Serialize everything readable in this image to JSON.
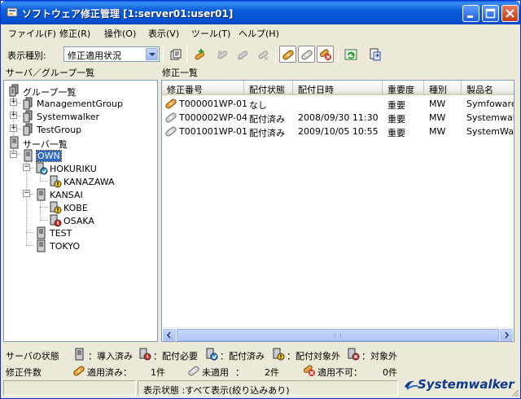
{
  "window": {
    "title": "ソフトウェア修正管理 [1:server01:user01]",
    "title_color": "#0a5fd8"
  },
  "menu": [
    "ファイル(F)",
    "修正(R)",
    "操作(O)",
    "表示(V)",
    "ツール(T)",
    "ヘルプ(H)"
  ],
  "toolbar": {
    "label": "表示種別:",
    "combo_value": "修正適用状況"
  },
  "left_pane": {
    "title": "サーバ／グループ一覧",
    "tree": {
      "group_root": "グループ一覧",
      "groups": [
        "ManagementGroup",
        "Systemwalker",
        "TestGroup"
      ],
      "server_root": "サーバ一覧",
      "own": "OWN",
      "hokuriku": "HOKURIKU",
      "kanazawa": "KANAZAWA",
      "kansai": "KANSAI",
      "kobe": "KOBE",
      "osaka": "OSAKA",
      "test": "TEST",
      "tokyo": "TOKYO"
    }
  },
  "right_pane": {
    "title": "修正一覧",
    "columns": [
      "修正番号",
      "配付状態",
      "配付日時",
      "重要度",
      "種別",
      "製品名"
    ],
    "rows": [
      {
        "id": "T000001WP-01",
        "status": "なし",
        "date": "",
        "importance": "重要",
        "type": "MW",
        "product": "Symfoware",
        "icon": "applied-bandage-icon"
      },
      {
        "id": "T000002WP-04",
        "status": "配付済み",
        "date": "2008/09/30 11:30",
        "importance": "重要",
        "type": "MW",
        "product": "Systemwall",
        "icon": "unapplied-bandage-icon"
      },
      {
        "id": "T001001WP-01",
        "status": "配付済み",
        "date": "2009/10/05 10:55",
        "importance": "重要",
        "type": "MW",
        "product": "SystemWall",
        "icon": "unapplied-bandage-icon"
      }
    ]
  },
  "legend": {
    "server_state_label": "サーバの状態",
    "installed": "：導入済み",
    "needs_distribution": "：配付必要",
    "distributed": "：配付済み",
    "not_target": "：配付対象外",
    "target_excluded": "：対象外",
    "fix_count_label": "修正件数",
    "applied_label": "適用済み：",
    "applied_count": "1件",
    "unapplied_label": "未適用",
    "unapplied_sep": "：",
    "unapplied_count": "2件",
    "not_applicable_label": "適用不可：",
    "not_applicable_count": "0件"
  },
  "status_bar": {
    "display_state": "表示状態 :すべて表示(絞り込みあり)"
  },
  "logo": "Systemwalker"
}
